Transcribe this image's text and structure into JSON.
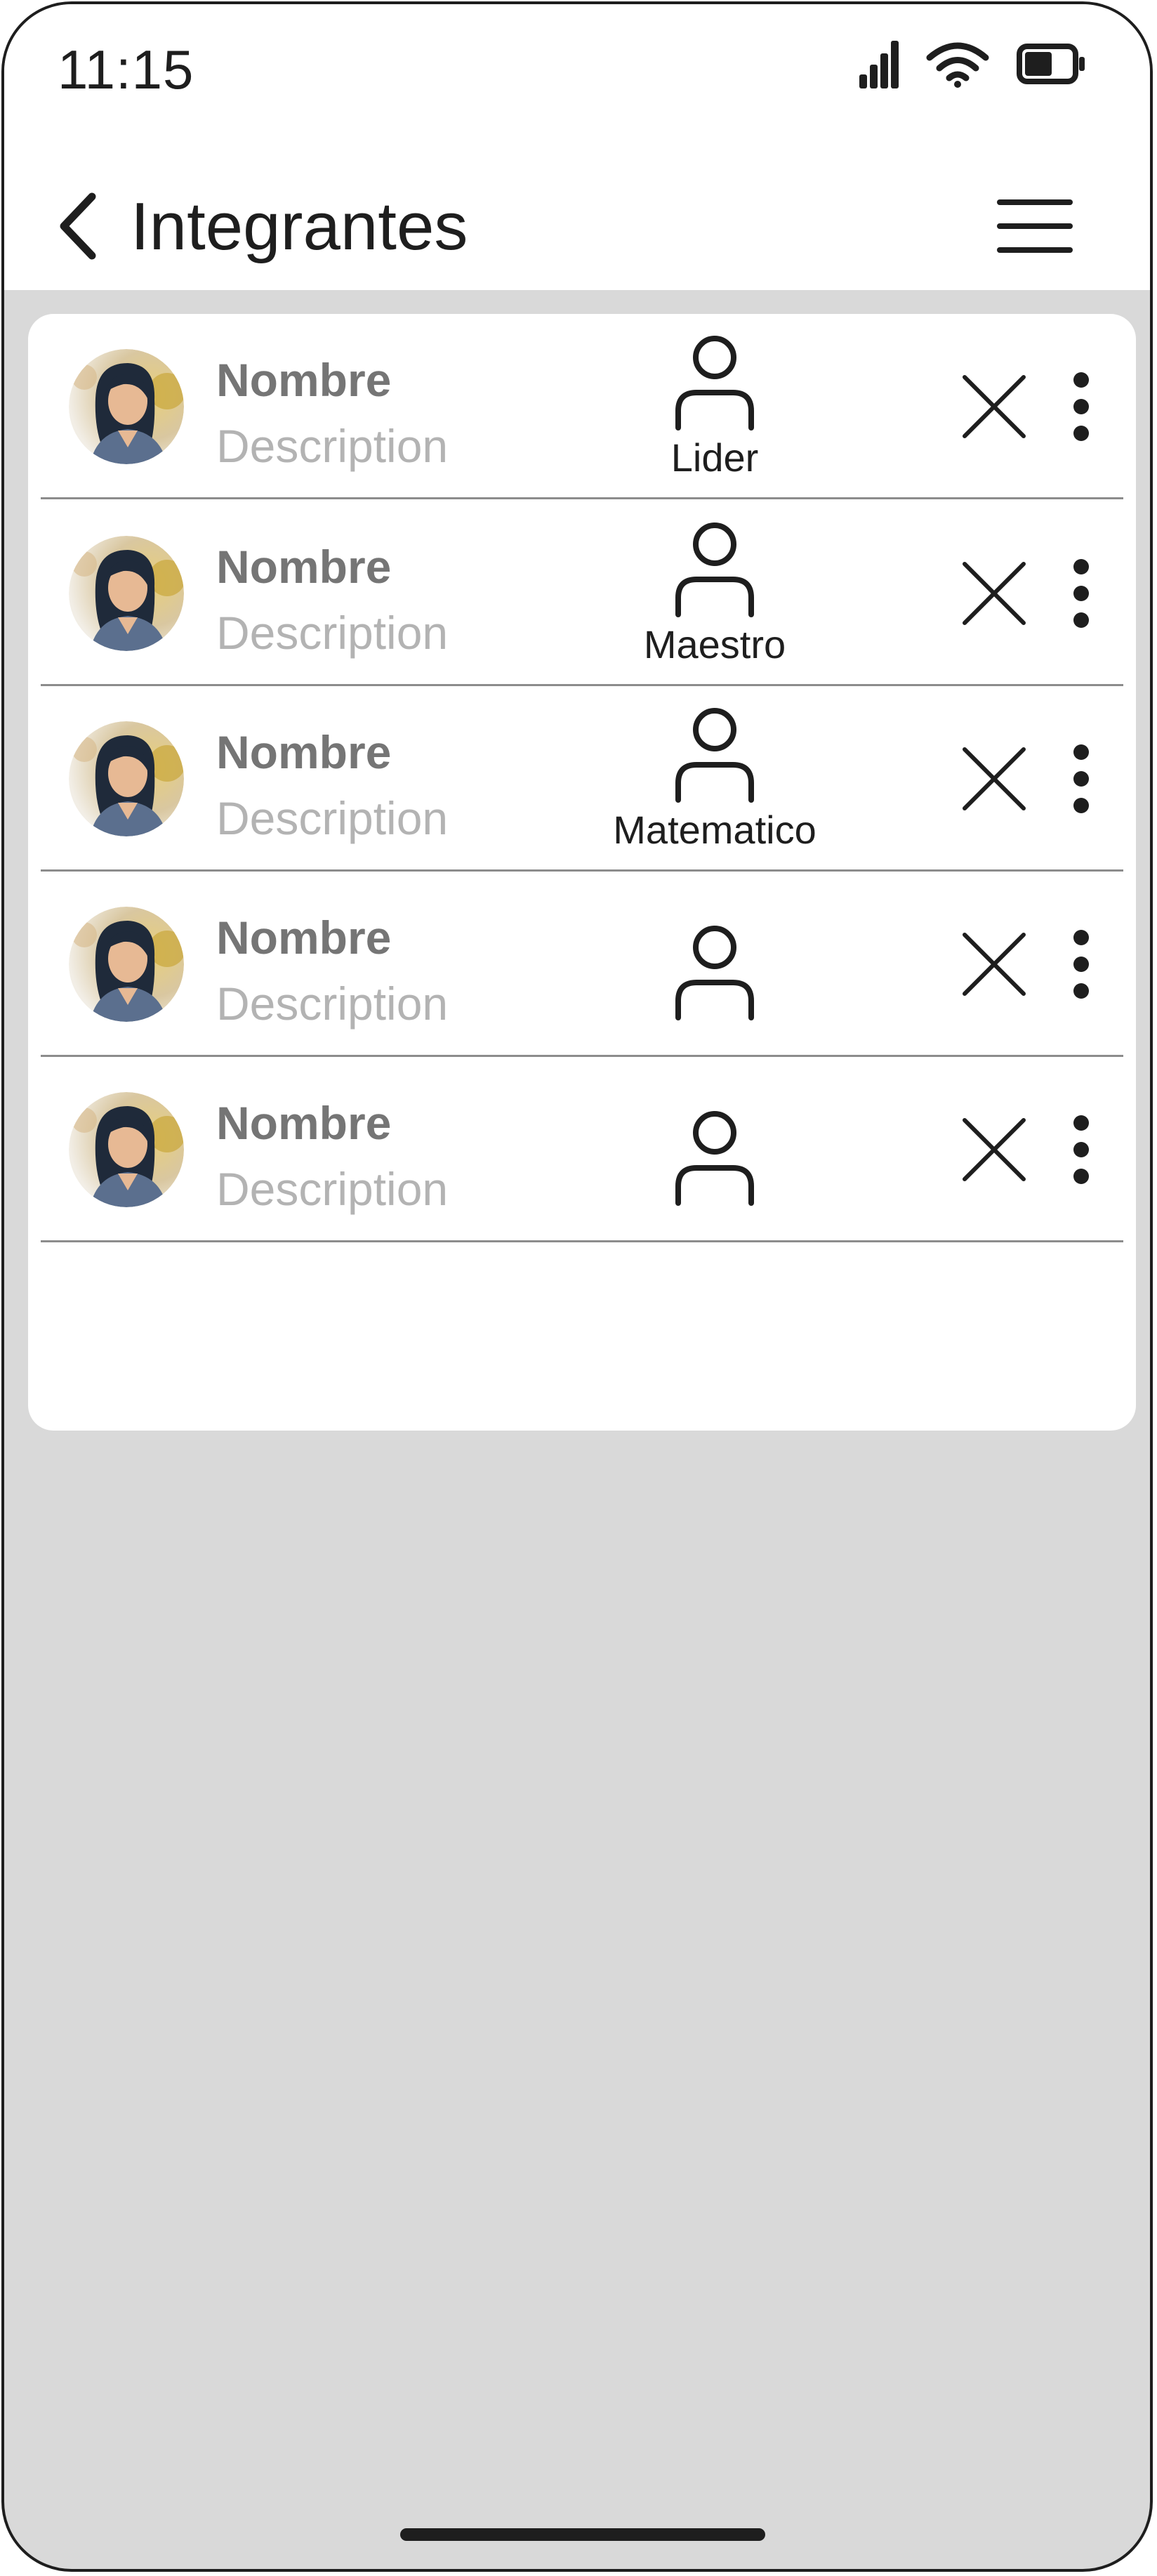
{
  "status_bar": {
    "time": "11:15",
    "icons": [
      "cellular-signal-icon",
      "wifi-icon",
      "battery-icon"
    ]
  },
  "header": {
    "title": "Integrantes",
    "back_icon": "chevron-left-icon",
    "menu_icon": "hamburger-menu-icon"
  },
  "members": [
    {
      "name": "Nombre",
      "description": "Description",
      "role": "Lider"
    },
    {
      "name": "Nombre",
      "description": "Description",
      "role": "Maestro"
    },
    {
      "name": "Nombre",
      "description": "Description",
      "role": "Matematico"
    },
    {
      "name": "Nombre",
      "description": "Description",
      "role": ""
    },
    {
      "name": "Nombre",
      "description": "Description",
      "role": ""
    }
  ],
  "colors": {
    "background": "#d9d9d9",
    "surface": "#ffffff",
    "text_primary": "#1e1e1e",
    "name_text": "#757575",
    "description_text": "#b3b3b3",
    "divider": "#8c8c8c"
  }
}
